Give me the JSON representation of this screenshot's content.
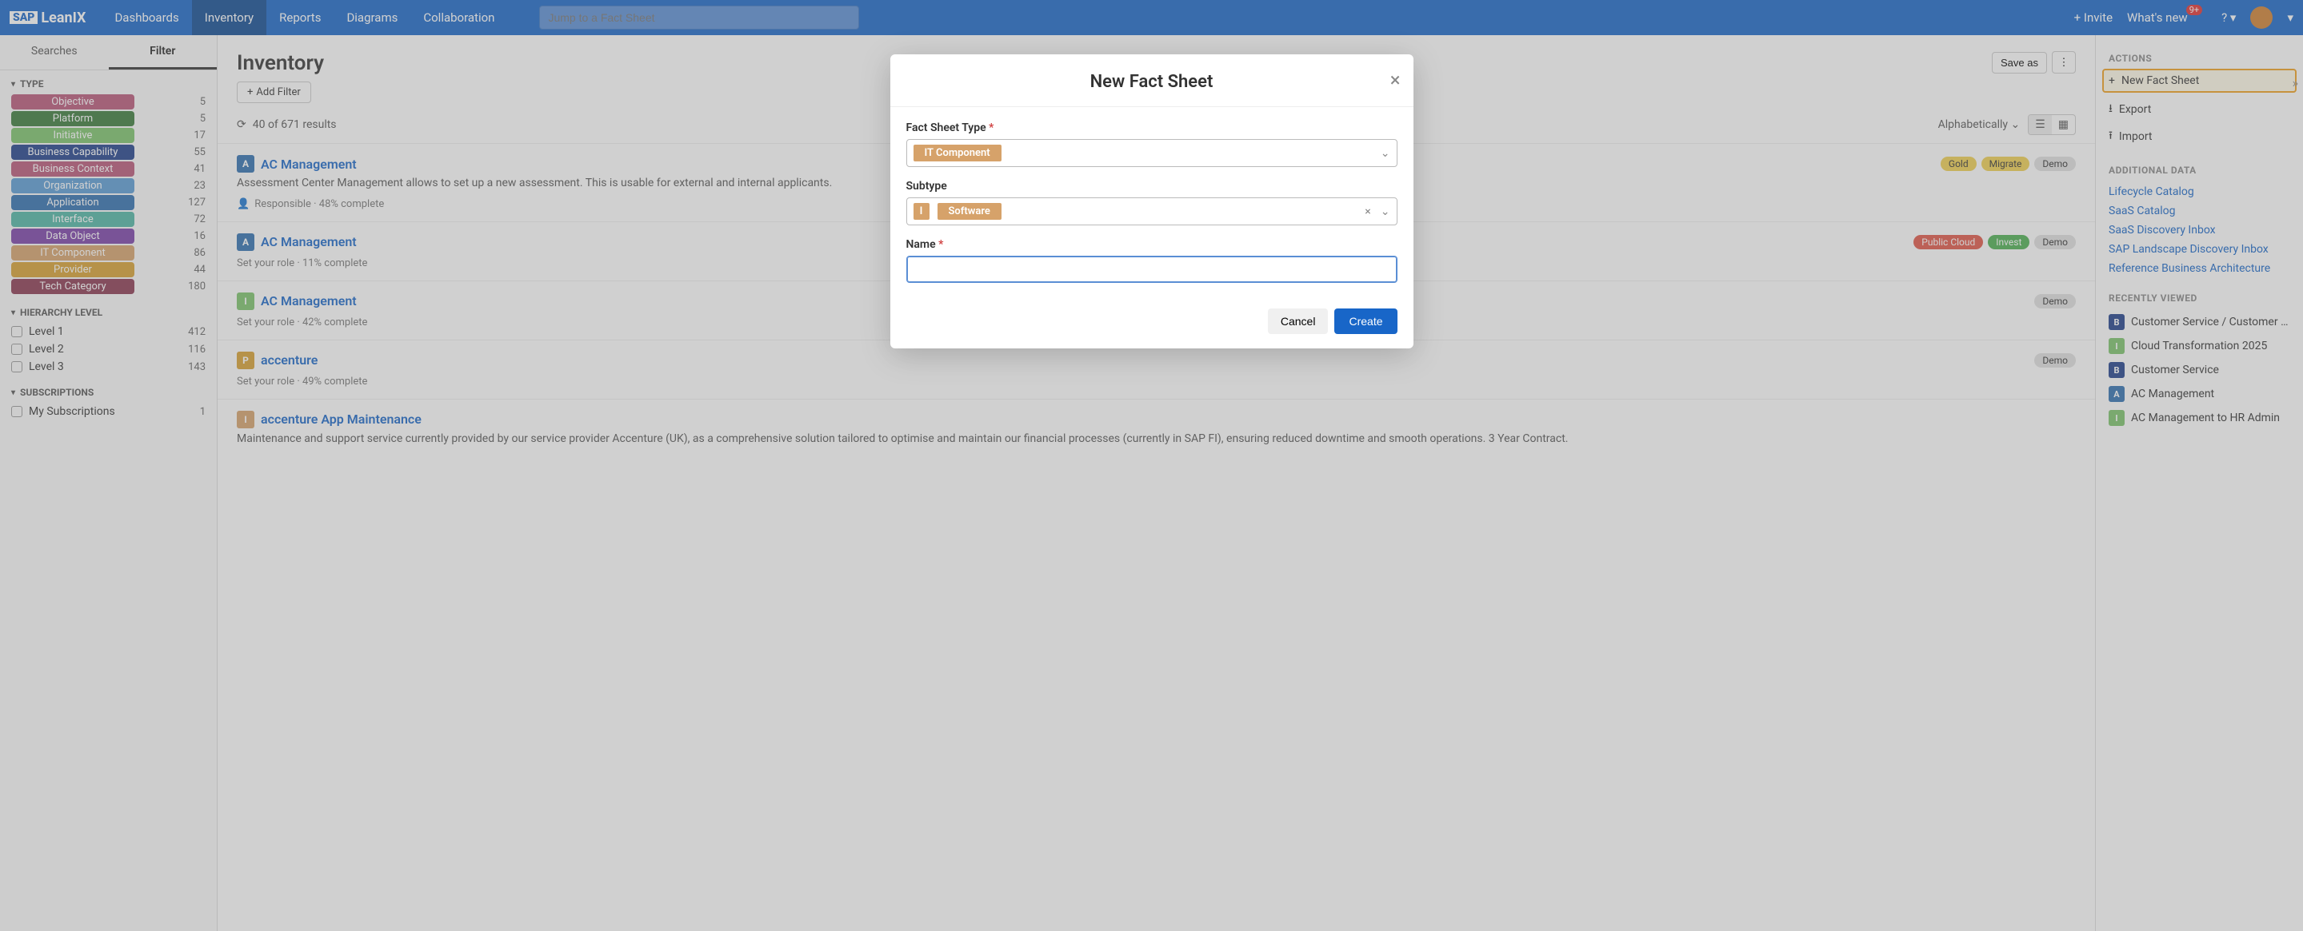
{
  "topnav": {
    "logo_sap": "SAP",
    "logo_name": "LeanIX",
    "items": [
      "Dashboards",
      "Inventory",
      "Reports",
      "Diagrams",
      "Collaboration"
    ],
    "active_idx": 1,
    "search_placeholder": "Jump to a Fact Sheet",
    "invite": "+ Invite",
    "whatsnew": "What's new",
    "notif": "9+"
  },
  "sidebar_left": {
    "tabs": [
      "Searches",
      "Filter"
    ],
    "active_tab": 1,
    "type_head": "TYPE",
    "types": [
      {
        "label": "Objective",
        "count": 5,
        "bg": "#b85679"
      },
      {
        "label": "Platform",
        "count": 5,
        "bg": "#3a7a3a"
      },
      {
        "label": "Initiative",
        "count": 17,
        "bg": "#7cc36b"
      },
      {
        "label": "Business Capability",
        "count": 55,
        "bg": "#1f3f8a"
      },
      {
        "label": "Business Context",
        "count": 41,
        "bg": "#b85679"
      },
      {
        "label": "Organization",
        "count": 23,
        "bg": "#5a9bd4"
      },
      {
        "label": "Application",
        "count": 127,
        "bg": "#2f6fb0"
      },
      {
        "label": "Interface",
        "count": 72,
        "bg": "#4fb5a5"
      },
      {
        "label": "Data Object",
        "count": 16,
        "bg": "#7a3fa8"
      },
      {
        "label": "IT Component",
        "count": 86,
        "bg": "#d6a26a"
      },
      {
        "label": "Provider",
        "count": 44,
        "bg": "#d8a030"
      },
      {
        "label": "Tech Category",
        "count": 180,
        "bg": "#8a3850"
      }
    ],
    "hierarchy_head": "HIERARCHY LEVEL",
    "levels": [
      {
        "label": "Level 1",
        "count": 412
      },
      {
        "label": "Level 2",
        "count": 116
      },
      {
        "label": "Level 3",
        "count": 143
      }
    ],
    "subs_head": "SUBSCRIPTIONS",
    "subs": [
      {
        "label": "My Subscriptions",
        "count": 1
      }
    ]
  },
  "main": {
    "title": "Inventory",
    "save_as": "Save as",
    "add_filter": "Add Filter",
    "results": "40 of 671 results",
    "sort": "Alphabetically",
    "items": [
      {
        "icon": "A",
        "icon_bg": "#2f6fb0",
        "title": "AC Management",
        "desc": "Assessment Center Management allows to set up a new assessment. This is usable for external and internal applicants.",
        "meta_icon": "person",
        "meta": "Responsible · 48% complete",
        "tags": [
          {
            "t": "Gold",
            "bg": "#f0d050"
          },
          {
            "t": "Migrate",
            "bg": "#f0d050"
          },
          {
            "t": "Demo",
            "bg": "#e0e0e0"
          }
        ]
      },
      {
        "icon": "A",
        "icon_bg": "#2f6fb0",
        "title": "AC Management",
        "desc": "",
        "meta": "Set your role · 11% complete",
        "tags": [
          {
            "t": "Public Cloud",
            "bg": "#e05545",
            "fg": "#fff"
          },
          {
            "t": "Invest",
            "bg": "#4caf50",
            "fg": "#fff"
          },
          {
            "t": "Demo",
            "bg": "#e0e0e0"
          }
        ]
      },
      {
        "icon": "I",
        "icon_bg": "#7cc36b",
        "title": "AC Management",
        "desc": "",
        "meta": "Set your role · 42% complete",
        "tags": [
          {
            "t": "Demo",
            "bg": "#e0e0e0"
          }
        ]
      },
      {
        "icon": "P",
        "icon_bg": "#d8a030",
        "title": "accenture",
        "desc": "",
        "meta": "Set your role · 49% complete",
        "tags": [
          {
            "t": "Demo",
            "bg": "#e0e0e0"
          }
        ]
      },
      {
        "icon": "I",
        "icon_bg": "#d6a26a",
        "title": "accenture App Maintenance",
        "desc": "Maintenance and support service currently provided by our service provider Accenture (UK), as a comprehensive solution tailored to optimise and maintain our financial processes (currently in SAP FI), ensuring reduced downtime and smooth operations. 3 Year Contract.",
        "meta": "",
        "tags": []
      }
    ]
  },
  "sidebar_right": {
    "actions_head": "ACTIONS",
    "actions": [
      {
        "icon": "+",
        "label": "New Fact Sheet",
        "hl": true
      },
      {
        "icon": "⭳",
        "label": "Export"
      },
      {
        "icon": "⭱",
        "label": "Import"
      }
    ],
    "addl_head": "ADDITIONAL DATA",
    "addl": [
      "Lifecycle Catalog",
      "SaaS Catalog",
      "SaaS Discovery Inbox",
      "SAP Landscape Discovery Inbox",
      "Reference Business Architecture"
    ],
    "recent_head": "RECENTLY VIEWED",
    "recent": [
      {
        "icon": "B",
        "bg": "#1f3f8a",
        "label": "Customer Service / Customer …"
      },
      {
        "icon": "I",
        "bg": "#7cc36b",
        "label": "Cloud Transformation 2025"
      },
      {
        "icon": "B",
        "bg": "#1f3f8a",
        "label": "Customer Service"
      },
      {
        "icon": "A",
        "bg": "#2f6fb0",
        "label": "AC Management"
      },
      {
        "icon": "I",
        "bg": "#7cc36b",
        "label": "AC Management to HR Admin"
      }
    ]
  },
  "modal": {
    "title": "New Fact Sheet",
    "fs_type_label": "Fact Sheet Type",
    "fs_type_value": "IT Component",
    "subtype_label": "Subtype",
    "subtype_icon": "I",
    "subtype_value": "Software",
    "name_label": "Name",
    "cancel": "Cancel",
    "create": "Create"
  }
}
